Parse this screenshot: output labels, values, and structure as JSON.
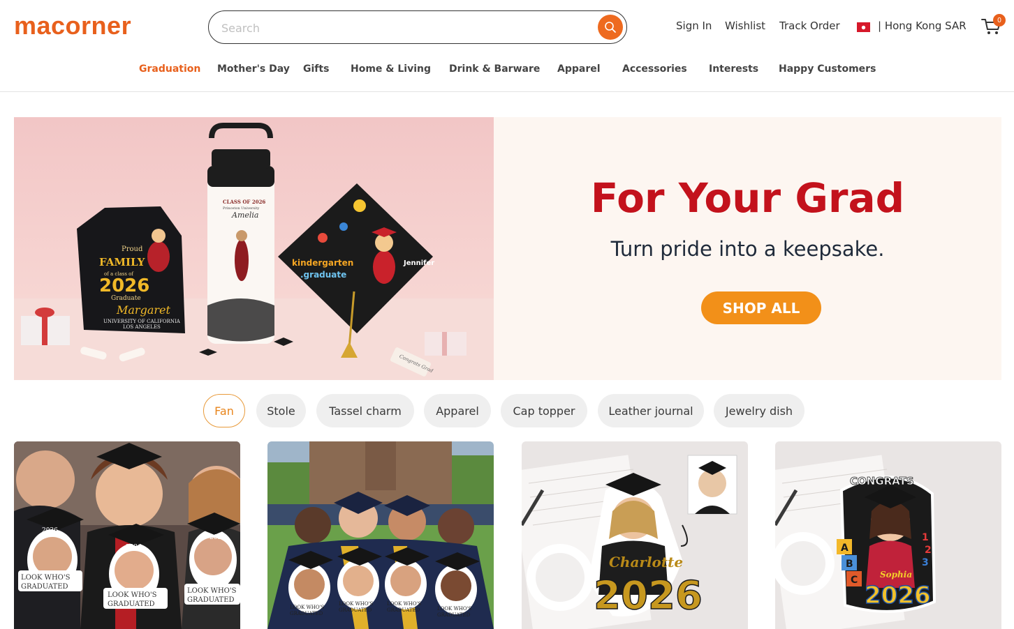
{
  "header": {
    "logo": "macorner",
    "search_placeholder": "Search",
    "sign_in": "Sign In",
    "wishlist": "Wishlist",
    "track_order": "Track Order",
    "region": "| Hong Kong SAR",
    "cart_count": "0"
  },
  "nav": {
    "items": [
      {
        "label": "Graduation",
        "active": true
      },
      {
        "label": "Mother's Day"
      },
      {
        "label": "Gifts"
      },
      {
        "label": "Home & Living"
      },
      {
        "label": "Drink & Barware"
      },
      {
        "label": "Apparel"
      },
      {
        "label": "Accessories"
      },
      {
        "label": "Interests"
      },
      {
        "label": "Happy Customers"
      }
    ]
  },
  "hero": {
    "title": "For Your Grad",
    "subtitle": "Turn pride into a keepsake.",
    "cta": "SHOP ALL",
    "image": {
      "shirt_lines": [
        "Proud",
        "FAMILY",
        "of a class of",
        "2026",
        "Graduate",
        "Margaret",
        "UNIVERSITY OF CALIFORNIA",
        "LOS ANGELES"
      ],
      "tumbler_lines": [
        "CLASS OF 2026",
        "Princeton University",
        "Amelia"
      ],
      "cap_lines": [
        "kindergarten",
        ".graduate",
        "Jennifer"
      ],
      "tag_text": "Congrats Grad"
    }
  },
  "filters": {
    "chips": [
      {
        "label": "Fan",
        "active": true
      },
      {
        "label": "Stole"
      },
      {
        "label": "Tassel charm"
      },
      {
        "label": "Apparel"
      },
      {
        "label": "Cap topper"
      },
      {
        "label": "Leather journal"
      },
      {
        "label": "Jewelry dish"
      }
    ]
  },
  "products": {
    "card1": {
      "year": "2026",
      "caption_1": "LOOK WHO'S",
      "caption_2": "GRADUATED"
    },
    "card2": {
      "caption_1": "LOOK WHO'S",
      "caption_2": "GRADUATED"
    },
    "card3": {
      "name": "Charlotte",
      "year": "2026"
    },
    "card4": {
      "top": "CONGRATS",
      "name": "Sophia",
      "year": "2026",
      "letters": [
        "A",
        "B",
        "C"
      ],
      "numbers": [
        "1",
        "2",
        "3"
      ]
    }
  },
  "colors": {
    "brand": "#e8601c",
    "hero_title": "#c3121c",
    "cta": "#f29019"
  }
}
